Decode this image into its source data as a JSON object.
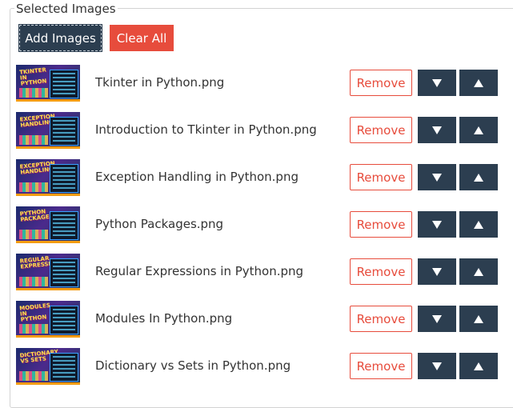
{
  "section": {
    "legend": "Selected Images"
  },
  "toolbar": {
    "add_label": "Add Images",
    "clear_label": "Clear All"
  },
  "colors": {
    "primary_dark": "#2c3e50",
    "danger": "#e74c3c",
    "text": "#333333"
  },
  "items": [
    {
      "filename": "Tkinter in Python.png",
      "thumb_title": "TKINTER IN PYTHON",
      "remove_label": "Remove",
      "down_icon": "triangle-down-icon",
      "up_icon": "triangle-up-icon"
    },
    {
      "filename": "Introduction to Tkinter in Python.png",
      "thumb_title": "EXCEPTION HANDLING",
      "remove_label": "Remove",
      "down_icon": "triangle-down-icon",
      "up_icon": "triangle-up-icon"
    },
    {
      "filename": "Exception Handling in Python.png",
      "thumb_title": "EXCEPTION HANDLING",
      "remove_label": "Remove",
      "down_icon": "triangle-down-icon",
      "up_icon": "triangle-up-icon"
    },
    {
      "filename": "Python Packages.png",
      "thumb_title": "PYTHON PACKAGES",
      "remove_label": "Remove",
      "down_icon": "triangle-down-icon",
      "up_icon": "triangle-up-icon"
    },
    {
      "filename": "Regular Expressions in Python.png",
      "thumb_title": "REGULAR EXPRESSIONS",
      "remove_label": "Remove",
      "down_icon": "triangle-down-icon",
      "up_icon": "triangle-up-icon"
    },
    {
      "filename": "Modules In Python.png",
      "thumb_title": "MODULES IN PYTHON",
      "remove_label": "Remove",
      "down_icon": "triangle-down-icon",
      "up_icon": "triangle-up-icon"
    },
    {
      "filename": "Dictionary vs Sets in Python.png",
      "thumb_title": "DICTIONARY VS SETS",
      "remove_label": "Remove",
      "down_icon": "triangle-down-icon",
      "up_icon": "triangle-up-icon"
    }
  ]
}
